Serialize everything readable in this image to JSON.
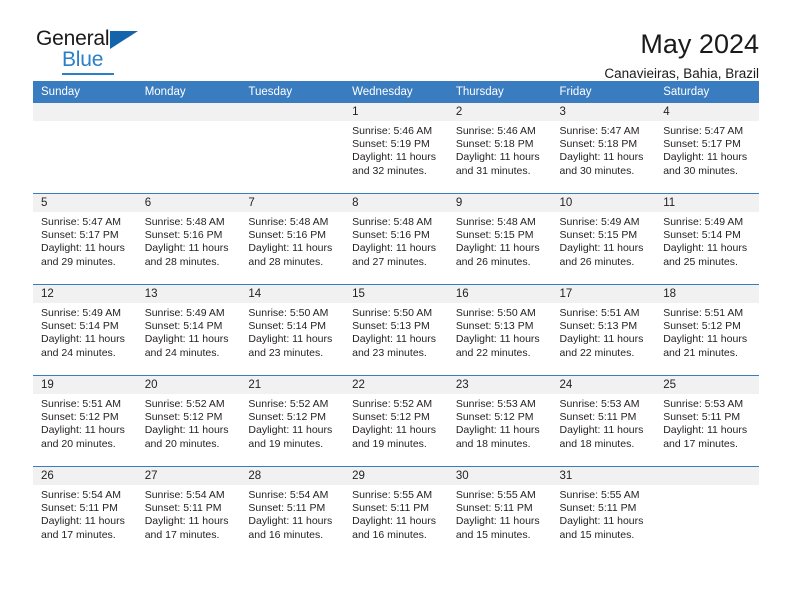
{
  "brand": {
    "name_part1": "General",
    "name_part2": "Blue",
    "triangle_color": "#1464ab",
    "blue_color": "#2a80c8"
  },
  "header": {
    "title": "May 2024",
    "subtitle": "Canavieiras, Bahia, Brazil",
    "header_bg": "#3a7cc0",
    "daynum_bg": "#f1f1f1"
  },
  "weekdays": [
    "Sunday",
    "Monday",
    "Tuesday",
    "Wednesday",
    "Thursday",
    "Friday",
    "Saturday"
  ],
  "labels": {
    "sunrise": "Sunrise:",
    "sunset": "Sunset:",
    "daylight": "Daylight:"
  },
  "weeks": [
    [
      {
        "day": "",
        "empty": true
      },
      {
        "day": "",
        "empty": true
      },
      {
        "day": "",
        "empty": true
      },
      {
        "day": "1",
        "sunrise": "Sunrise: 5:46 AM",
        "sunset": "Sunset: 5:19 PM",
        "daylight1": "Daylight: 11 hours",
        "daylight2": "and 32 minutes."
      },
      {
        "day": "2",
        "sunrise": "Sunrise: 5:46 AM",
        "sunset": "Sunset: 5:18 PM",
        "daylight1": "Daylight: 11 hours",
        "daylight2": "and 31 minutes."
      },
      {
        "day": "3",
        "sunrise": "Sunrise: 5:47 AM",
        "sunset": "Sunset: 5:18 PM",
        "daylight1": "Daylight: 11 hours",
        "daylight2": "and 30 minutes."
      },
      {
        "day": "4",
        "sunrise": "Sunrise: 5:47 AM",
        "sunset": "Sunset: 5:17 PM",
        "daylight1": "Daylight: 11 hours",
        "daylight2": "and 30 minutes."
      }
    ],
    [
      {
        "day": "5",
        "sunrise": "Sunrise: 5:47 AM",
        "sunset": "Sunset: 5:17 PM",
        "daylight1": "Daylight: 11 hours",
        "daylight2": "and 29 minutes."
      },
      {
        "day": "6",
        "sunrise": "Sunrise: 5:48 AM",
        "sunset": "Sunset: 5:16 PM",
        "daylight1": "Daylight: 11 hours",
        "daylight2": "and 28 minutes."
      },
      {
        "day": "7",
        "sunrise": "Sunrise: 5:48 AM",
        "sunset": "Sunset: 5:16 PM",
        "daylight1": "Daylight: 11 hours",
        "daylight2": "and 28 minutes."
      },
      {
        "day": "8",
        "sunrise": "Sunrise: 5:48 AM",
        "sunset": "Sunset: 5:16 PM",
        "daylight1": "Daylight: 11 hours",
        "daylight2": "and 27 minutes."
      },
      {
        "day": "9",
        "sunrise": "Sunrise: 5:48 AM",
        "sunset": "Sunset: 5:15 PM",
        "daylight1": "Daylight: 11 hours",
        "daylight2": "and 26 minutes."
      },
      {
        "day": "10",
        "sunrise": "Sunrise: 5:49 AM",
        "sunset": "Sunset: 5:15 PM",
        "daylight1": "Daylight: 11 hours",
        "daylight2": "and 26 minutes."
      },
      {
        "day": "11",
        "sunrise": "Sunrise: 5:49 AM",
        "sunset": "Sunset: 5:14 PM",
        "daylight1": "Daylight: 11 hours",
        "daylight2": "and 25 minutes."
      }
    ],
    [
      {
        "day": "12",
        "sunrise": "Sunrise: 5:49 AM",
        "sunset": "Sunset: 5:14 PM",
        "daylight1": "Daylight: 11 hours",
        "daylight2": "and 24 minutes."
      },
      {
        "day": "13",
        "sunrise": "Sunrise: 5:49 AM",
        "sunset": "Sunset: 5:14 PM",
        "daylight1": "Daylight: 11 hours",
        "daylight2": "and 24 minutes."
      },
      {
        "day": "14",
        "sunrise": "Sunrise: 5:50 AM",
        "sunset": "Sunset: 5:14 PM",
        "daylight1": "Daylight: 11 hours",
        "daylight2": "and 23 minutes."
      },
      {
        "day": "15",
        "sunrise": "Sunrise: 5:50 AM",
        "sunset": "Sunset: 5:13 PM",
        "daylight1": "Daylight: 11 hours",
        "daylight2": "and 23 minutes."
      },
      {
        "day": "16",
        "sunrise": "Sunrise: 5:50 AM",
        "sunset": "Sunset: 5:13 PM",
        "daylight1": "Daylight: 11 hours",
        "daylight2": "and 22 minutes."
      },
      {
        "day": "17",
        "sunrise": "Sunrise: 5:51 AM",
        "sunset": "Sunset: 5:13 PM",
        "daylight1": "Daylight: 11 hours",
        "daylight2": "and 22 minutes."
      },
      {
        "day": "18",
        "sunrise": "Sunrise: 5:51 AM",
        "sunset": "Sunset: 5:12 PM",
        "daylight1": "Daylight: 11 hours",
        "daylight2": "and 21 minutes."
      }
    ],
    [
      {
        "day": "19",
        "sunrise": "Sunrise: 5:51 AM",
        "sunset": "Sunset: 5:12 PM",
        "daylight1": "Daylight: 11 hours",
        "daylight2": "and 20 minutes."
      },
      {
        "day": "20",
        "sunrise": "Sunrise: 5:52 AM",
        "sunset": "Sunset: 5:12 PM",
        "daylight1": "Daylight: 11 hours",
        "daylight2": "and 20 minutes."
      },
      {
        "day": "21",
        "sunrise": "Sunrise: 5:52 AM",
        "sunset": "Sunset: 5:12 PM",
        "daylight1": "Daylight: 11 hours",
        "daylight2": "and 19 minutes."
      },
      {
        "day": "22",
        "sunrise": "Sunrise: 5:52 AM",
        "sunset": "Sunset: 5:12 PM",
        "daylight1": "Daylight: 11 hours",
        "daylight2": "and 19 minutes."
      },
      {
        "day": "23",
        "sunrise": "Sunrise: 5:53 AM",
        "sunset": "Sunset: 5:12 PM",
        "daylight1": "Daylight: 11 hours",
        "daylight2": "and 18 minutes."
      },
      {
        "day": "24",
        "sunrise": "Sunrise: 5:53 AM",
        "sunset": "Sunset: 5:11 PM",
        "daylight1": "Daylight: 11 hours",
        "daylight2": "and 18 minutes."
      },
      {
        "day": "25",
        "sunrise": "Sunrise: 5:53 AM",
        "sunset": "Sunset: 5:11 PM",
        "daylight1": "Daylight: 11 hours",
        "daylight2": "and 17 minutes."
      }
    ],
    [
      {
        "day": "26",
        "sunrise": "Sunrise: 5:54 AM",
        "sunset": "Sunset: 5:11 PM",
        "daylight1": "Daylight: 11 hours",
        "daylight2": "and 17 minutes."
      },
      {
        "day": "27",
        "sunrise": "Sunrise: 5:54 AM",
        "sunset": "Sunset: 5:11 PM",
        "daylight1": "Daylight: 11 hours",
        "daylight2": "and 17 minutes."
      },
      {
        "day": "28",
        "sunrise": "Sunrise: 5:54 AM",
        "sunset": "Sunset: 5:11 PM",
        "daylight1": "Daylight: 11 hours",
        "daylight2": "and 16 minutes."
      },
      {
        "day": "29",
        "sunrise": "Sunrise: 5:55 AM",
        "sunset": "Sunset: 5:11 PM",
        "daylight1": "Daylight: 11 hours",
        "daylight2": "and 16 minutes."
      },
      {
        "day": "30",
        "sunrise": "Sunrise: 5:55 AM",
        "sunset": "Sunset: 5:11 PM",
        "daylight1": "Daylight: 11 hours",
        "daylight2": "and 15 minutes."
      },
      {
        "day": "31",
        "sunrise": "Sunrise: 5:55 AM",
        "sunset": "Sunset: 5:11 PM",
        "daylight1": "Daylight: 11 hours",
        "daylight2": "and 15 minutes."
      },
      {
        "day": "",
        "empty": true
      }
    ]
  ]
}
